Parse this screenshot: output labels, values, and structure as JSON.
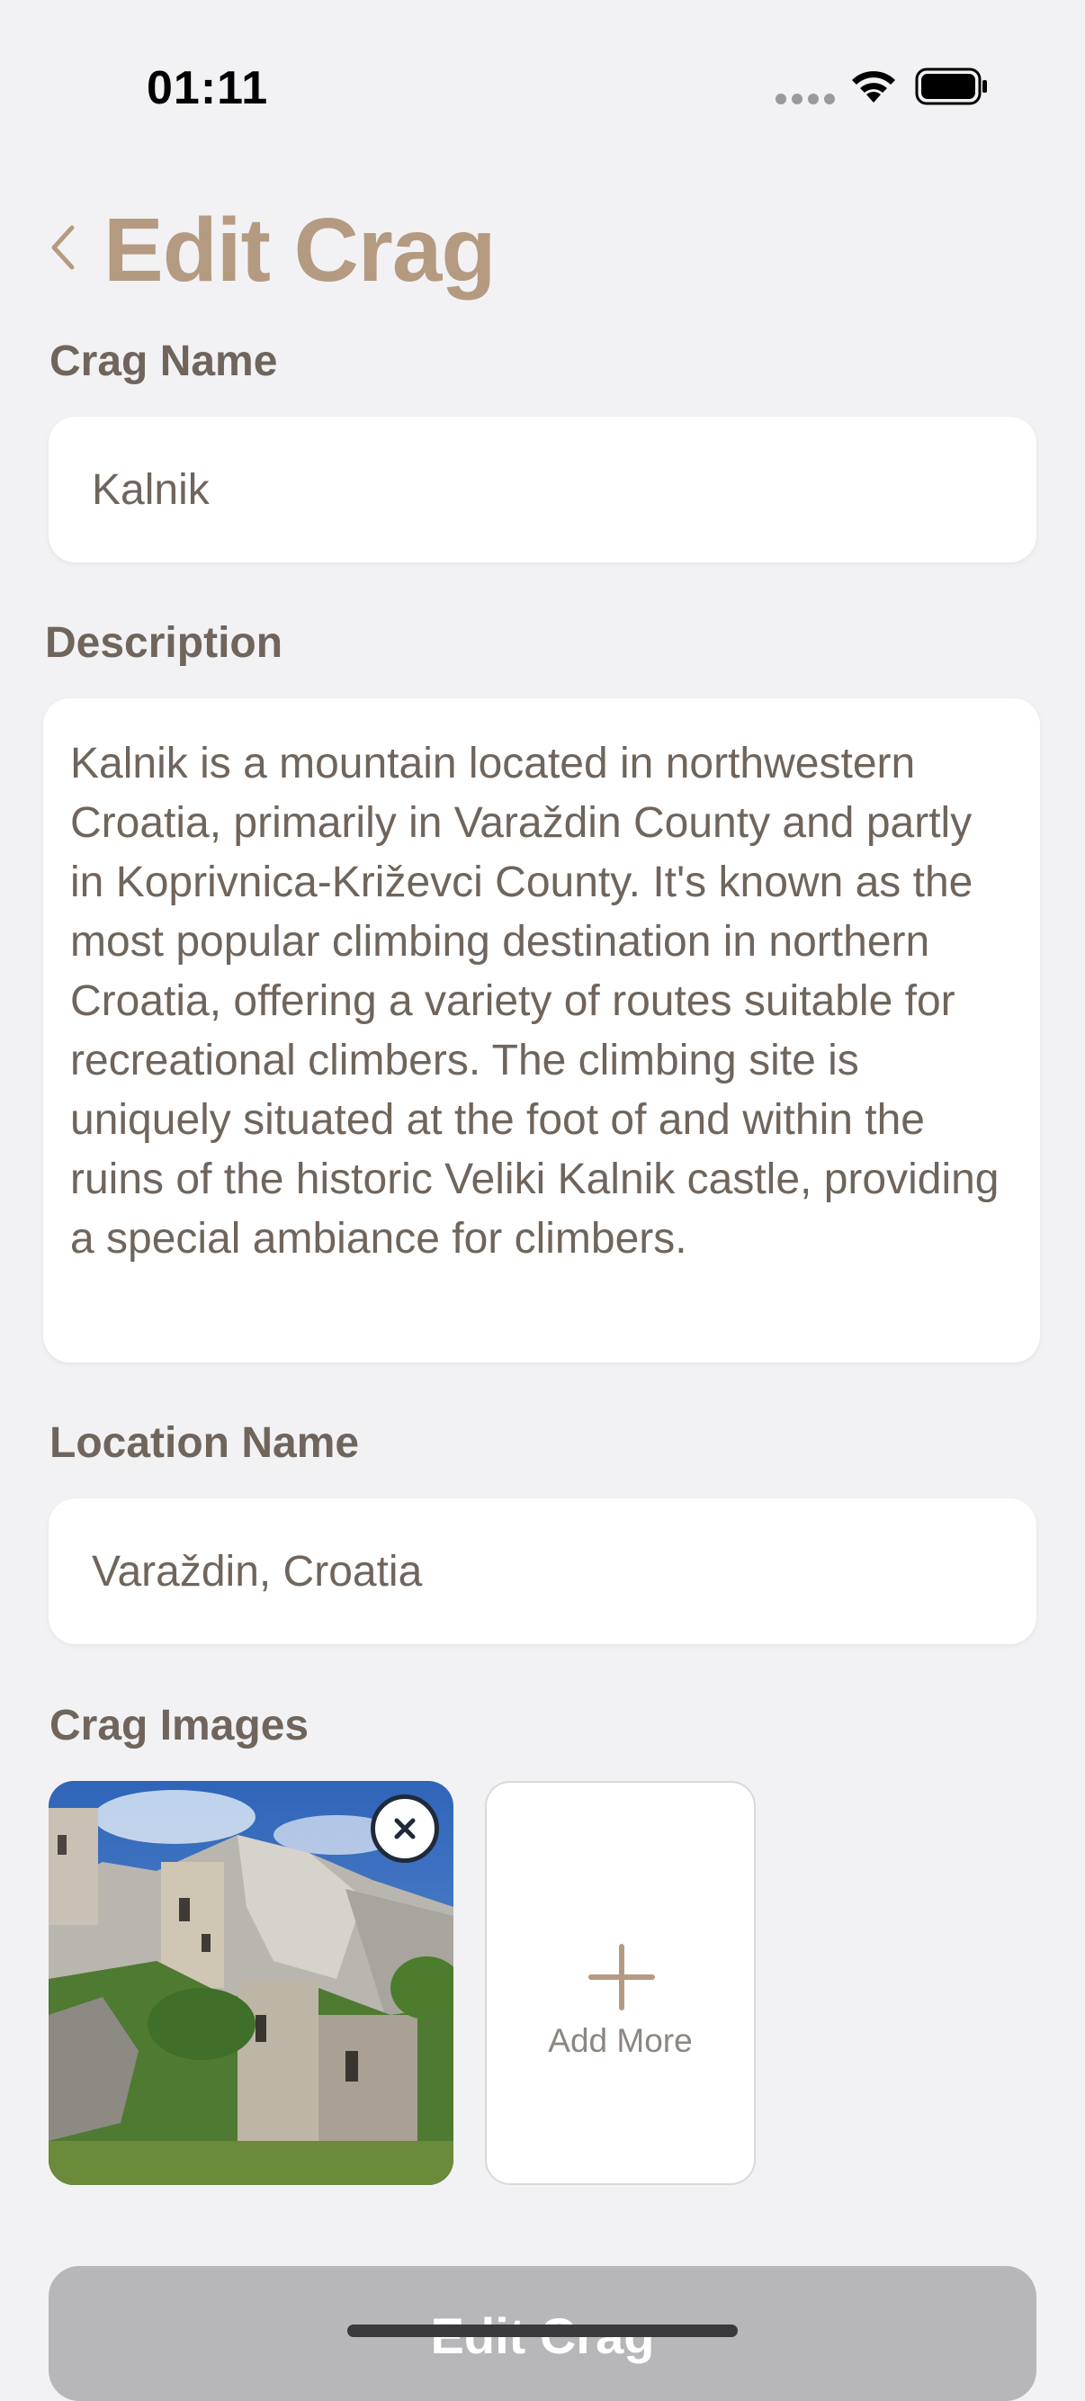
{
  "status_bar": {
    "time": "01:11"
  },
  "header": {
    "title": "Edit Crag"
  },
  "form": {
    "crag_name_label": "Crag Name",
    "crag_name_value": "Kalnik",
    "description_label": "Description",
    "description_value": "Kalnik is a mountain located in northwestern Croatia, primarily in Varaždin County and partly in Koprivnica-Križevci County. It's known as the most popular climbing destination in northern Croatia, offering a variety of routes suitable for recreational climbers. The climbing site is uniquely situated at the foot of and within the ruins of the historic Veliki Kalnik castle, providing a special ambiance for climbers.",
    "location_label": "Location Name",
    "location_value": "Varaždin, Croatia",
    "images_label": "Crag Images",
    "add_more_label": "Add More"
  },
  "submit": {
    "label": "Edit Crag"
  },
  "colors": {
    "accent": "#b59a82",
    "text": "#6f655c",
    "background": "#f2f2f4",
    "button_disabled": "#b7b7ba"
  }
}
